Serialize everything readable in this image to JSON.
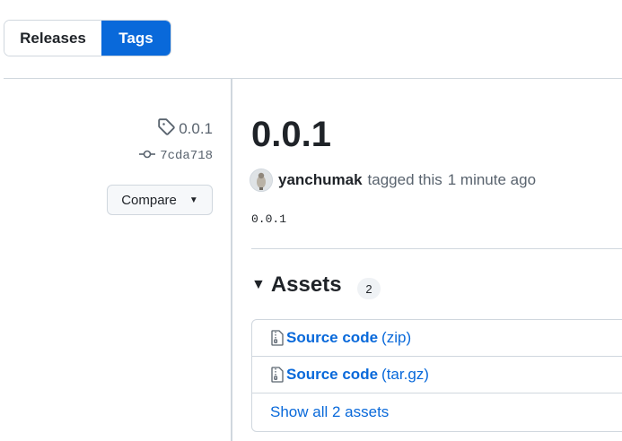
{
  "tabs": {
    "releases": "Releases",
    "tags": "Tags"
  },
  "sidebar": {
    "tag_name": "0.0.1",
    "commit": "7cda718",
    "compare_label": "Compare"
  },
  "release": {
    "title": "0.0.1",
    "author": "yanchumak",
    "action": "tagged this",
    "time": "1 minute ago",
    "body": "0.0.1"
  },
  "assets": {
    "heading": "Assets",
    "count": "2",
    "items": [
      {
        "name": "Source code",
        "ext": "(zip)",
        "icon": "file-zip-icon"
      },
      {
        "name": "Source code",
        "ext": "(tar.gz)",
        "icon": "file-zip-icon"
      }
    ],
    "show_all": "Show all 2 assets"
  },
  "colors": {
    "accent": "#0969da",
    "border": "#d0d7de",
    "muted": "#59636e"
  }
}
